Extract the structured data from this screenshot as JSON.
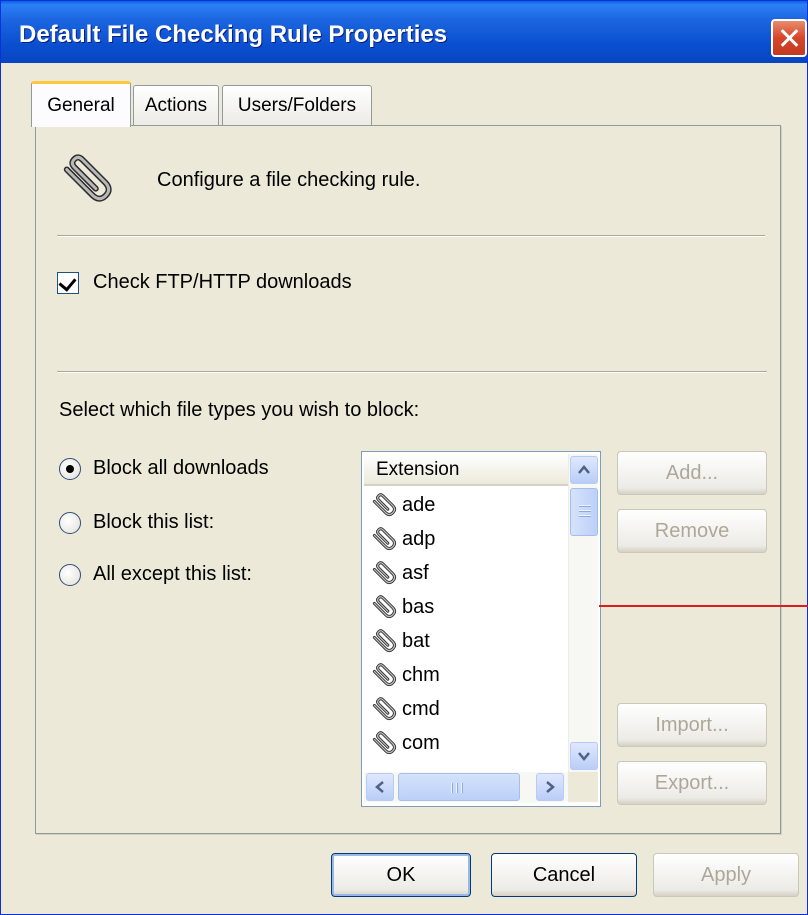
{
  "window": {
    "title": "Default File Checking Rule Properties"
  },
  "tabs": [
    {
      "label": "General",
      "active": true
    },
    {
      "label": "Actions",
      "active": false
    },
    {
      "label": "Users/Folders",
      "active": false
    }
  ],
  "intro": {
    "icon": "paperclip-icon",
    "text": "Configure a file checking rule."
  },
  "check_downloads": {
    "label": "Check FTP/HTTP downloads",
    "checked": true
  },
  "block_section": {
    "label": "Select which file types you wish to block:",
    "options": [
      {
        "label": "Block all downloads",
        "selected": true
      },
      {
        "label": "Block this list:",
        "selected": false
      },
      {
        "label": "All except this list:",
        "selected": false
      }
    ]
  },
  "extension_list": {
    "header": "Extension",
    "items": [
      "ade",
      "adp",
      "asf",
      "bas",
      "bat",
      "chm",
      "cmd",
      "com"
    ]
  },
  "side_buttons": {
    "add": "Add...",
    "remove": "Remove",
    "import": "Import...",
    "export": "Export..."
  },
  "footer_buttons": {
    "ok": "OK",
    "cancel": "Cancel",
    "apply": "Apply"
  },
  "colors": {
    "titlebar": "#0A4FD0",
    "dialog_bg": "#ECE9D8",
    "active_tab_accent": "#FFC83C",
    "annotation_line": "#D81E1E"
  }
}
